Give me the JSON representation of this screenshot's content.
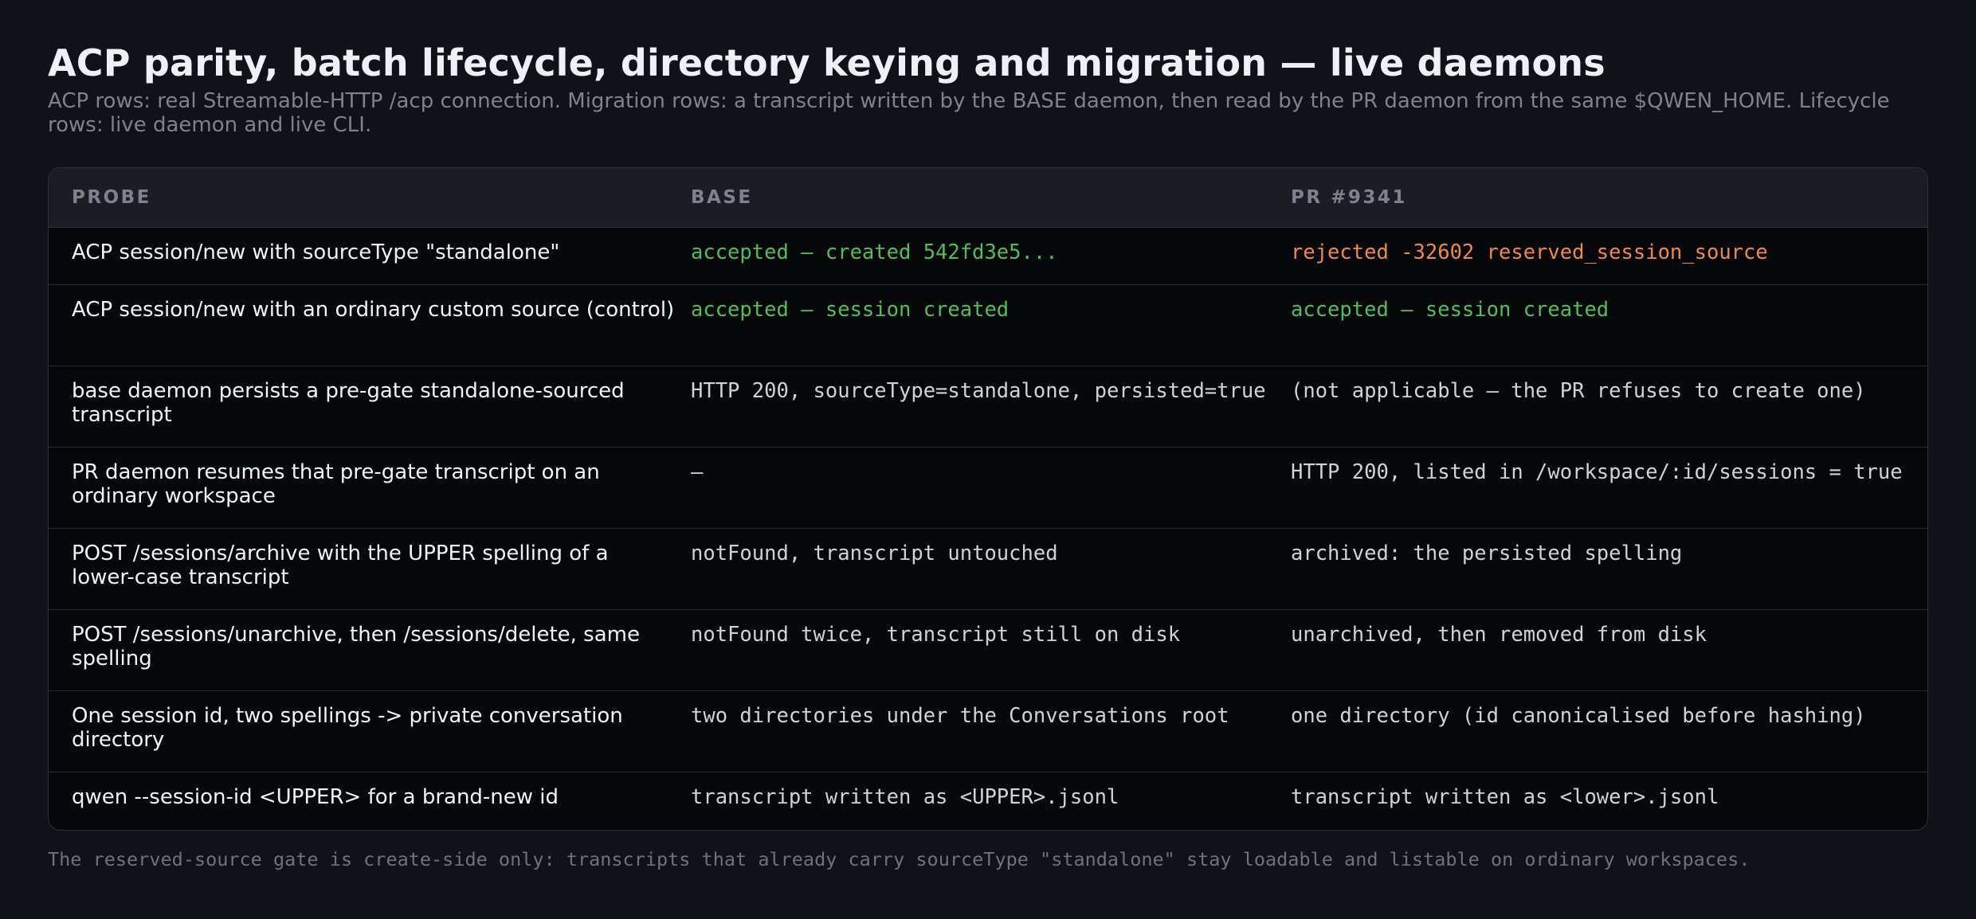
{
  "header": {
    "title": "ACP parity, batch lifecycle, directory keying and migration — live daemons",
    "subtitle": "ACP rows: real Streamable-HTTP /acp connection. Migration rows: a transcript written by the BASE daemon, then read by the PR daemon from the same $QWEN_HOME. Lifecycle rows: live daemon and live CLI."
  },
  "colors": {
    "accepted": "#4fbf56",
    "rejected": "#ee8a45",
    "muted": "#7d828c",
    "background": "#0f1218"
  },
  "table": {
    "columns": [
      "PROBE",
      "BASE",
      "PR #9341"
    ],
    "rows": [
      {
        "probe": "ACP session/new with sourceType \"standalone\"",
        "base": "accepted — created 542fd3e5...",
        "pr": "rejected -32602 reserved_session_source",
        "base_status": "ok",
        "pr_status": "bad"
      },
      {
        "probe": "ACP session/new with an ordinary custom source (control)",
        "base": "accepted — session created",
        "pr": "accepted — session created",
        "base_status": "ok",
        "pr_status": "ok"
      },
      {
        "probe": "base daemon persists a pre-gate standalone-sourced transcript",
        "base": "HTTP 200, sourceType=standalone, persisted=true",
        "pr": "(not applicable — the PR refuses to create one)",
        "base_status": "plain",
        "pr_status": "plain"
      },
      {
        "probe": "PR daemon resumes that pre-gate transcript on an ordinary workspace",
        "base": "—",
        "pr": "HTTP 200, listed in /workspace/:id/sessions = true",
        "base_status": "plain",
        "pr_status": "plain"
      },
      {
        "probe": "POST /sessions/archive with the UPPER spelling of a lower-case transcript",
        "base": "notFound, transcript untouched",
        "pr": "archived: the persisted spelling",
        "base_status": "plain",
        "pr_status": "plain"
      },
      {
        "probe": "POST /sessions/unarchive, then /sessions/delete, same spelling",
        "base": "notFound twice, transcript still on disk",
        "pr": "unarchived, then removed from disk",
        "base_status": "plain",
        "pr_status": "plain"
      },
      {
        "probe": "One session id, two spellings -> private conversation directory",
        "base": "two directories under the Conversations root",
        "pr": "one directory (id canonicalised before hashing)",
        "base_status": "plain",
        "pr_status": "plain"
      },
      {
        "probe": "qwen --session-id <UPPER> for a brand-new id",
        "base": "transcript written as <UPPER>.jsonl",
        "pr": "transcript written as <lower>.jsonl",
        "base_status": "plain",
        "pr_status": "plain"
      }
    ]
  },
  "footer": {
    "note": "The reserved-source gate is create-side only: transcripts that already carry sourceType \"standalone\" stay loadable and listable on ordinary workspaces."
  }
}
